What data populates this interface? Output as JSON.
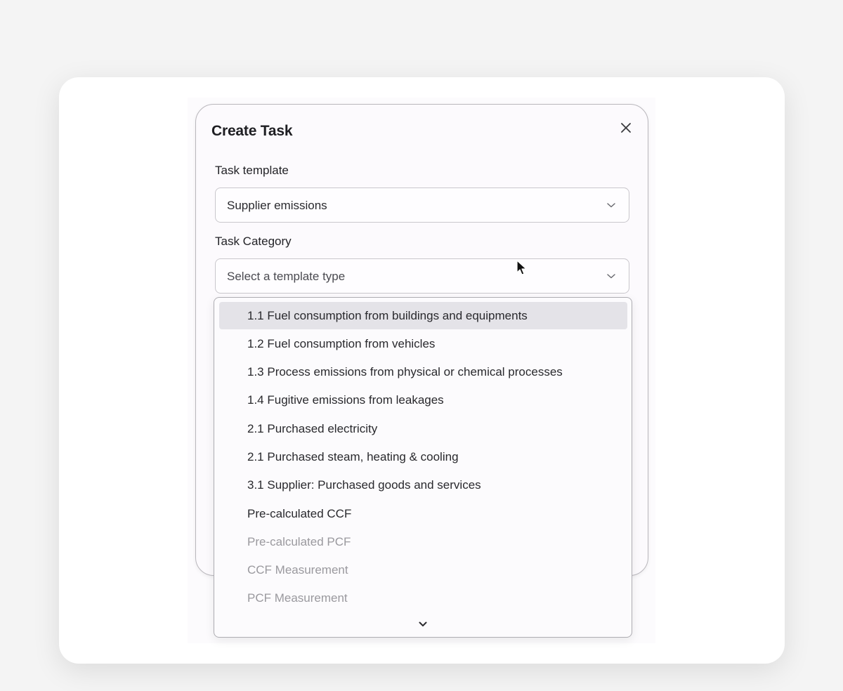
{
  "dialog": {
    "title": "Create Task",
    "close_icon": "close-icon"
  },
  "fields": {
    "task_template": {
      "label": "Task template",
      "value": "Supplier emissions"
    },
    "task_category": {
      "label": "Task Category",
      "placeholder": "Select a template type"
    }
  },
  "dropdown": {
    "options": [
      {
        "label": "1.1 Fuel consumption from buildings and equipments",
        "state": "highlighted"
      },
      {
        "label": "1.2 Fuel consumption from vehicles",
        "state": "enabled"
      },
      {
        "label": "1.3 Process emissions from physical or chemical processes",
        "state": "enabled"
      },
      {
        "label": "1.4 Fugitive emissions from leakages",
        "state": "enabled"
      },
      {
        "label": "2.1 Purchased electricity",
        "state": "enabled"
      },
      {
        "label": "2.1 Purchased steam, heating & cooling",
        "state": "enabled"
      },
      {
        "label": "3.1 Supplier: Purchased goods and services",
        "state": "enabled"
      },
      {
        "label": "Pre-calculated CCF",
        "state": "enabled"
      },
      {
        "label": "Pre-calculated PCF",
        "state": "disabled"
      },
      {
        "label": "CCF Measurement",
        "state": "disabled"
      },
      {
        "label": "PCF Measurement",
        "state": "disabled"
      }
    ],
    "scroll_icon": "chevron-down-icon"
  },
  "colors": {
    "highlight": "#e4e3e8",
    "text": "#29292d",
    "disabled_text": "#9a999e",
    "accent": "#c9bdf6"
  }
}
